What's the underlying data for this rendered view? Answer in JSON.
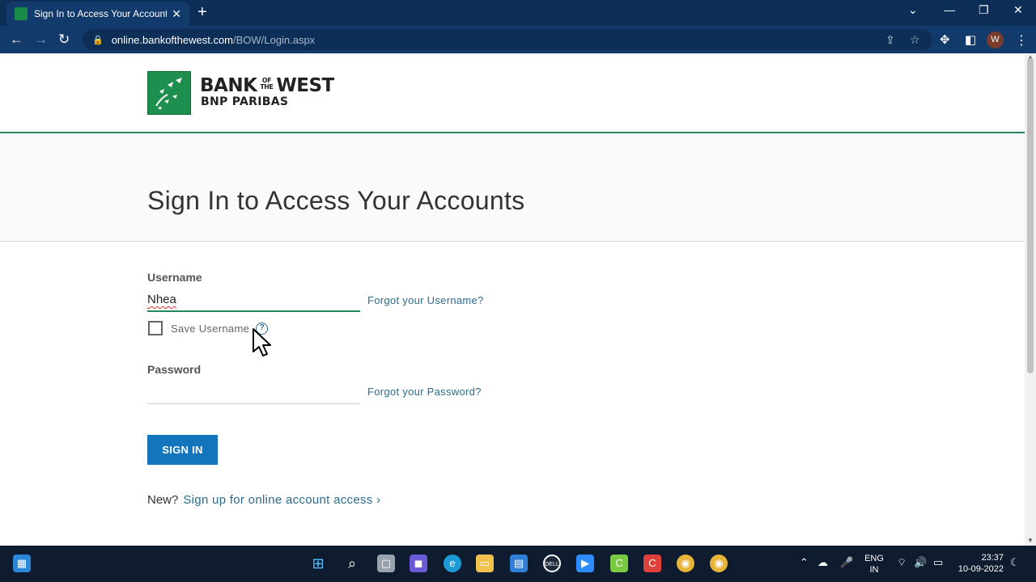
{
  "browser": {
    "tab_title": "Sign In to Access Your Accounts",
    "url_host": "online.bankofthewest.com",
    "url_path": "/BOW/Login.aspx",
    "profile_initial": "W"
  },
  "brand": {
    "line1_a": "BANK",
    "line1_small": "OF THE",
    "line1_b": "WEST",
    "line2": "BNP PARIBAS",
    "color": "#1e8f4e"
  },
  "page": {
    "title": "Sign In to Access Your Accounts"
  },
  "form": {
    "username_label": "Username",
    "username_value": "Nhea",
    "forgot_username": "Forgot your Username?",
    "save_username_label": "Save Username",
    "help_glyph": "?",
    "password_label": "Password",
    "forgot_password": "Forgot your Password?",
    "signin_label": "SIGN IN",
    "new_prefix": "New?",
    "signup_link": "Sign up for online account access ›"
  },
  "taskbar": {
    "lang_line1": "ENG",
    "lang_line2": "IN",
    "time": "23:37",
    "date": "10-09-2022"
  },
  "colors": {
    "accent_green": "#1f8a5a",
    "button_blue": "#1475bd",
    "link_blue": "#2a6b8f"
  }
}
